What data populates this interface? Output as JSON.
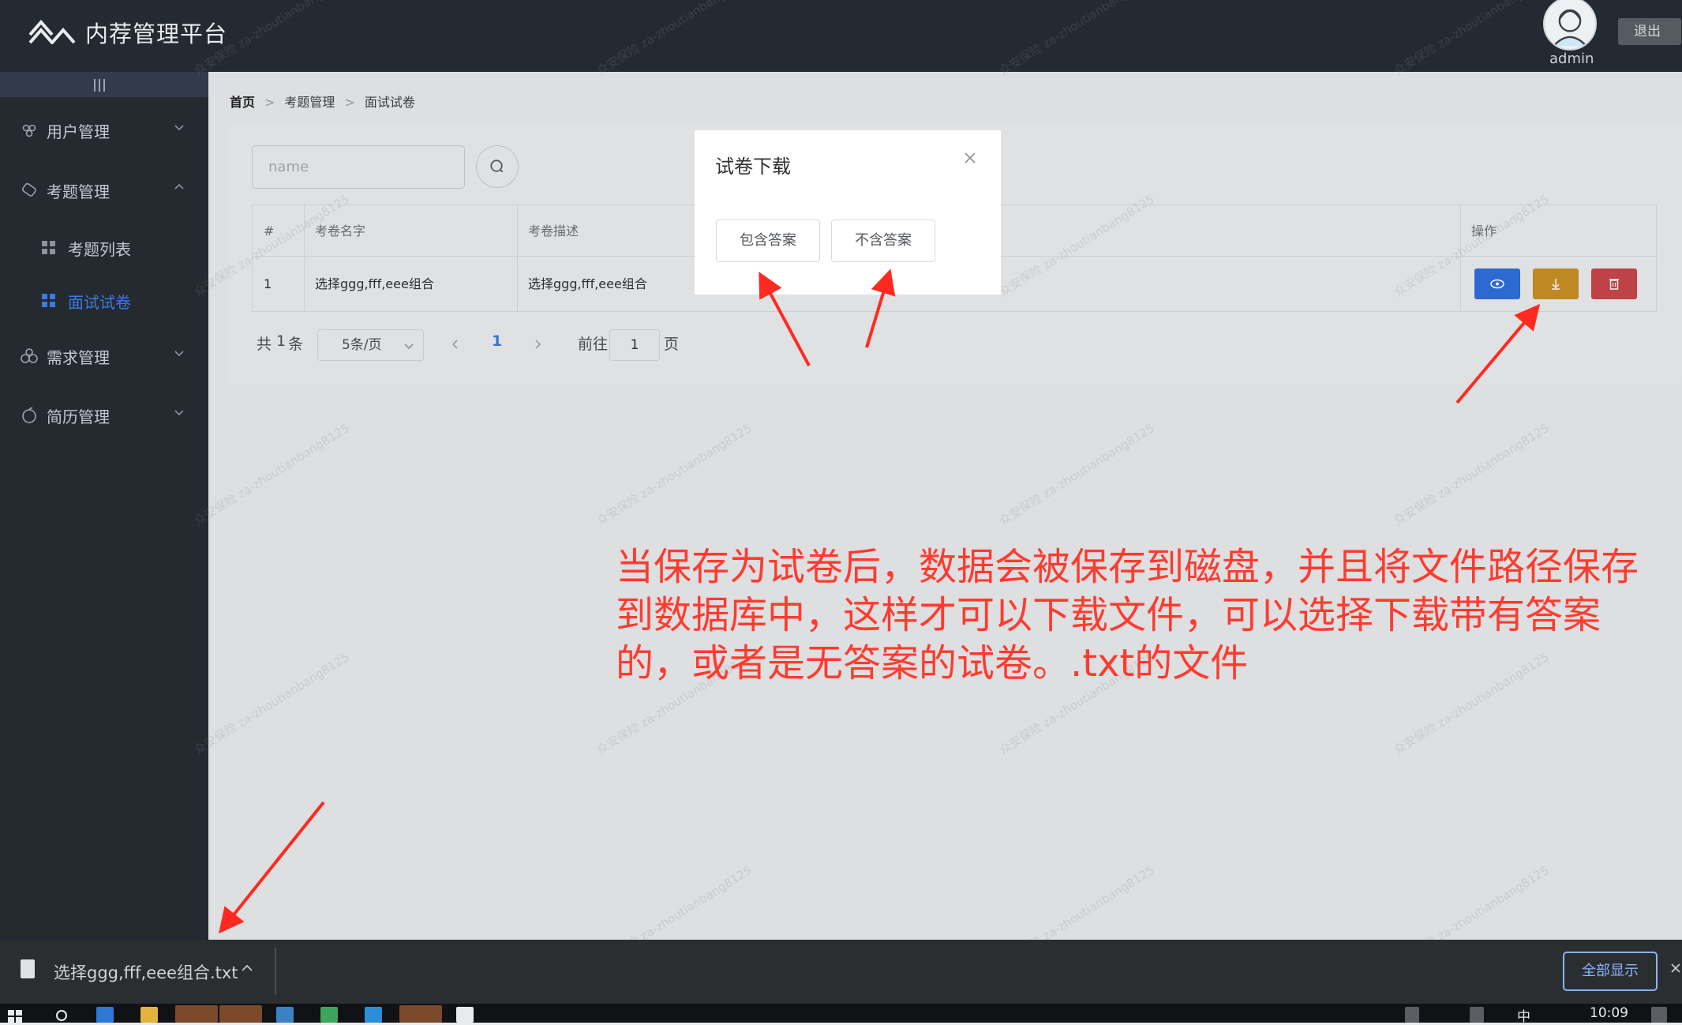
{
  "app": {
    "title": "内荐管理平台",
    "user": "admin",
    "logout": "退出"
  },
  "sidebar": {
    "items": [
      {
        "label": "用户管理",
        "icon": "users-icon",
        "expanded": false
      },
      {
        "label": "考题管理",
        "icon": "questions-icon",
        "expanded": true
      },
      {
        "label": "需求管理",
        "icon": "demand-icon",
        "expanded": false
      },
      {
        "label": "简历管理",
        "icon": "resume-icon",
        "expanded": false
      }
    ],
    "sub_items": [
      {
        "label": "考题列表",
        "active": false
      },
      {
        "label": "面试试卷",
        "active": true
      }
    ]
  },
  "breadcrumb": [
    "首页",
    "考题管理",
    "面试试卷"
  ],
  "search": {
    "placeholder": "name"
  },
  "table": {
    "headers": [
      "#",
      "考卷名字",
      "考卷描述",
      "操作"
    ],
    "rows": [
      {
        "index": "1",
        "name": "选择ggg,fff,eee组合",
        "description": "选择ggg,fff,eee组合"
      }
    ]
  },
  "pagination": {
    "total_prefix": "共",
    "total": "1",
    "total_suffix": "条",
    "page_size": "5条/页",
    "current_page": "1",
    "goto_label": "前往",
    "goto_value": "1",
    "goto_suffix": "页"
  },
  "dialog": {
    "title": "试卷下载",
    "with_answers": "包含答案",
    "without_answers": "不含答案"
  },
  "annotation": {
    "text": "当保存为试卷后，数据会被保存到磁盘，并且将文件路径保存到数据库中，这样才可以下载文件，可以选择下载带有答案的，或者是无答案的试卷。.txt的文件",
    "color": "#ff3b2f"
  },
  "download_bar": {
    "file_name": "选择ggg,fff,eee组合.txt",
    "show_all": "全部显示"
  },
  "taskbar": {
    "ime": "中",
    "clock": "10:09"
  },
  "colors": {
    "header_bg": "#242a31",
    "sidebar_bg": "#252a31",
    "accent": "#3b7be0",
    "view_button": "#2f6fdc",
    "download_button": "#c99024",
    "delete_button": "#c9464a"
  },
  "watermark": {
    "line1": "众安保险",
    "line2": "za-zhoutianbang8125"
  }
}
